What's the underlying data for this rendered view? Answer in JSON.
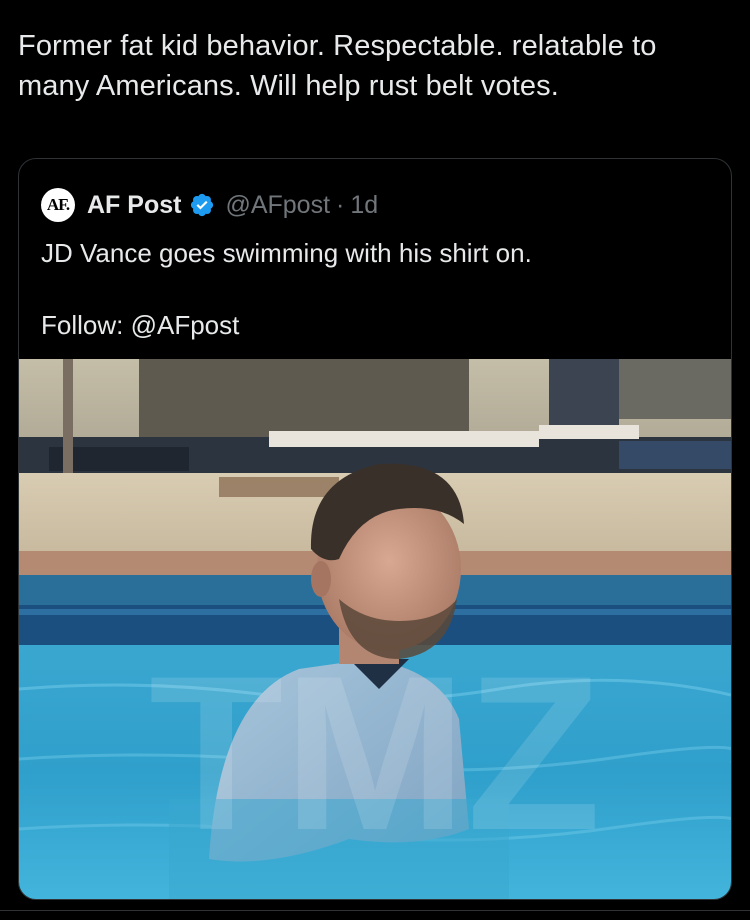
{
  "post": {
    "text": "Former fat kid behavior. Respectable. relatable to many Americans. Will help rust belt votes."
  },
  "quoted_post": {
    "avatar_text": "AF.",
    "display_name": "AF Post",
    "verified": true,
    "handle": "@AFpost",
    "separator": "·",
    "age": "1d",
    "text_line1": "JD Vance goes swimming with his shirt on.",
    "text_line2": "Follow: @AFpost",
    "media_watermark": "TMZ"
  },
  "colors": {
    "background": "#000000",
    "text": "#e7e9ea",
    "muted": "#71767b",
    "border": "#2f3336",
    "verified": "#1d9bf0"
  }
}
